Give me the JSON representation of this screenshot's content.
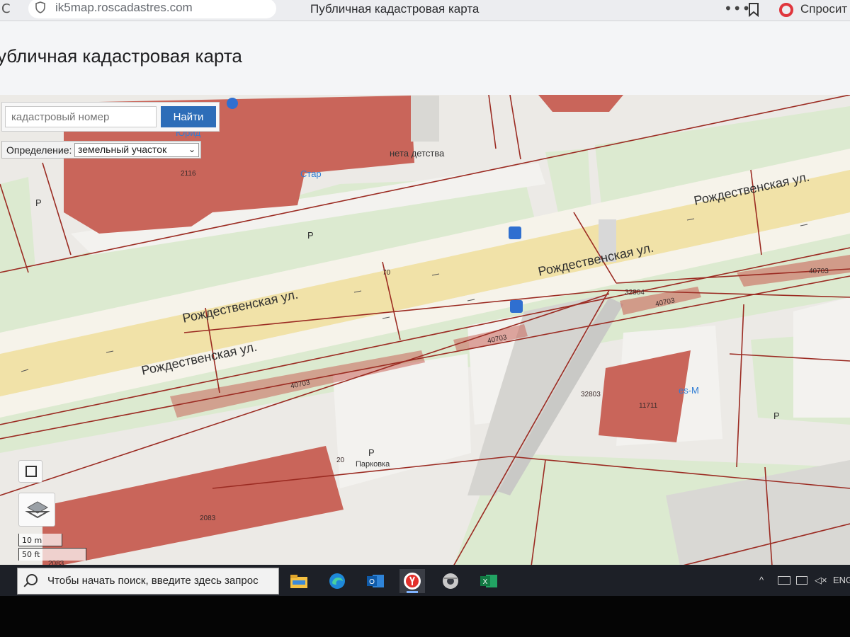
{
  "browser": {
    "url": "ik5map.roscadastres.com",
    "tab_title": "Публичная кадастровая карта",
    "ask_label": "Спросит"
  },
  "page": {
    "heading": "убличная кадастровая карта"
  },
  "search": {
    "placeholder": "кадастровый номер",
    "button_label": "Найти",
    "definition_label": "Определение:",
    "definition_value": "земельный участок"
  },
  "map": {
    "streets": [
      "Рождественская ул.",
      "Рождественская ул.",
      "Рождественская ул.",
      "Рождественская ул."
    ],
    "parcel_numbers": [
      "2116",
      "70",
      "40703",
      "40703",
      "40703",
      "40703",
      "32804",
      "32803",
      "11711",
      "20",
      "2083",
      "2083"
    ],
    "pois": {
      "yurid": "Юрид",
      "star": "Стар",
      "detstva": "нета детства",
      "parking": "Парковка",
      "ees": "es-M"
    },
    "parking_marks": [
      "P",
      "P",
      "P",
      "P"
    ],
    "scale": {
      "metric": "10 m",
      "imperial": "50 ft"
    },
    "colors": {
      "background": "#eceae6",
      "building": "#c9655a",
      "road": "#f1e2a8",
      "green": "#dcead0",
      "cadastre_line": "#9b2b22"
    }
  },
  "taskbar": {
    "search_text": "Чтобы начать поиск, введите здесь запрос",
    "language": "ENG",
    "apps": [
      "file-explorer-icon",
      "edge-icon",
      "outlook-icon",
      "yandex-browser-icon",
      "chrome-canary-icon",
      "excel-icon"
    ]
  }
}
